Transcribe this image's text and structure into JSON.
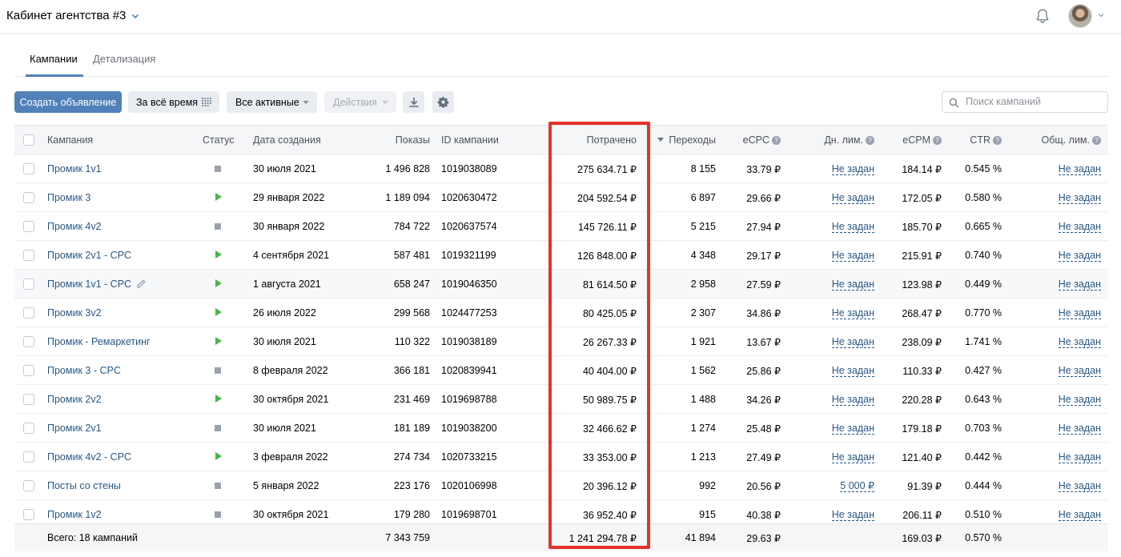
{
  "header": {
    "title": "Кабинет агентства #3"
  },
  "tabs": [
    {
      "label": "Кампании"
    },
    {
      "label": "Детализация"
    }
  ],
  "toolbar": {
    "create_label": "Создать объявление",
    "time_label": "За всё время",
    "filter_label": "Все активные",
    "actions_label": "Действия"
  },
  "search": {
    "placeholder": "Поиск кампаний",
    "value": ""
  },
  "columns": {
    "campaign": "Кампания",
    "status": "Статус",
    "created": "Дата создания",
    "shows": "Показы",
    "id": "ID кампании",
    "spent": "Потрачено",
    "clicks": "Переходы",
    "ecpc": "eCPC",
    "day_limit": "Дн. лим.",
    "ecpm": "eCPM",
    "ctr": "CTR",
    "total_limit": "Общ. лим."
  },
  "help_mark": "?",
  "rows": [
    {
      "name": "Промик 1v1",
      "status": "stopped",
      "created": "30 июля 2021",
      "shows": "1 496 828",
      "id": "1019038089",
      "spent": "275 634.71 ₽",
      "clicks": "8 155",
      "ecpc": "33.79 ₽",
      "day_limit": "Не задан",
      "ecpm": "184.14 ₽",
      "ctr": "0.545 %",
      "total_limit": "Не задан"
    },
    {
      "name": "Промик 3",
      "status": "active",
      "created": "29 января 2022",
      "shows": "1 189 094",
      "id": "1020630472",
      "spent": "204 592.54 ₽",
      "clicks": "6 897",
      "ecpc": "29.66 ₽",
      "day_limit": "Не задан",
      "ecpm": "172.05 ₽",
      "ctr": "0.580 %",
      "total_limit": "Не задан"
    },
    {
      "name": "Промик 4v2",
      "status": "stopped",
      "created": "30 января 2022",
      "shows": "784 722",
      "id": "1020637574",
      "spent": "145 726.11 ₽",
      "clicks": "5 215",
      "ecpc": "27.94 ₽",
      "day_limit": "Не задан",
      "ecpm": "185.70 ₽",
      "ctr": "0.665 %",
      "total_limit": "Не задан"
    },
    {
      "name": "Промик 2v1 - CPC",
      "status": "active",
      "created": "4 сентября 2021",
      "shows": "587 481",
      "id": "1019321199",
      "spent": "126 848.00 ₽",
      "clicks": "4 348",
      "ecpc": "29.17 ₽",
      "day_limit": "Не задан",
      "ecpm": "215.91 ₽",
      "ctr": "0.740 %",
      "total_limit": "Не задан"
    },
    {
      "name": "Промик 1v1 - CPC",
      "status": "active",
      "created": "1 августа 2021",
      "shows": "658 247",
      "id": "1019046350",
      "spent": "81 614.50 ₽",
      "clicks": "2 958",
      "ecpc": "27.59 ₽",
      "day_limit": "Не задан",
      "ecpm": "123.98 ₽",
      "ctr": "0.449 %",
      "total_limit": "Не задан",
      "hover": true
    },
    {
      "name": "Промик 3v2",
      "status": "active",
      "created": "26 июля 2022",
      "shows": "299 568",
      "id": "1024477253",
      "spent": "80 425.05 ₽",
      "clicks": "2 307",
      "ecpc": "34.86 ₽",
      "day_limit": "Не задан",
      "ecpm": "268.47 ₽",
      "ctr": "0.770 %",
      "total_limit": "Не задан"
    },
    {
      "name": "Промик - Ремаркетинг",
      "status": "active",
      "created": "30 июля 2021",
      "shows": "110 322",
      "id": "1019038189",
      "spent": "26 267.33 ₽",
      "clicks": "1 921",
      "ecpc": "13.67 ₽",
      "day_limit": "Не задан",
      "ecpm": "238.09 ₽",
      "ctr": "1.741 %",
      "total_limit": "Не задан"
    },
    {
      "name": "Промик 3 - CPC",
      "status": "stopped",
      "created": "8 февраля 2022",
      "shows": "366 181",
      "id": "1020839941",
      "spent": "40 404.00 ₽",
      "clicks": "1 562",
      "ecpc": "25.86 ₽",
      "day_limit": "Не задан",
      "ecpm": "110.33 ₽",
      "ctr": "0.427 %",
      "total_limit": "Не задан"
    },
    {
      "name": "Промик 2v2",
      "status": "active",
      "created": "30 октября 2021",
      "shows": "231 469",
      "id": "1019698788",
      "spent": "50 989.75 ₽",
      "clicks": "1 488",
      "ecpc": "34.26 ₽",
      "day_limit": "Не задан",
      "ecpm": "220.28 ₽",
      "ctr": "0.643 %",
      "total_limit": "Не задан"
    },
    {
      "name": "Промик 2v1",
      "status": "stopped",
      "created": "30 июля 2021",
      "shows": "181 189",
      "id": "1019038200",
      "spent": "32 466.62 ₽",
      "clicks": "1 274",
      "ecpc": "25.48 ₽",
      "day_limit": "Не задан",
      "ecpm": "179.18 ₽",
      "ctr": "0.703 %",
      "total_limit": "Не задан"
    },
    {
      "name": "Промик 4v2 - CPC",
      "status": "active",
      "created": "3 февраля 2022",
      "shows": "274 734",
      "id": "1020733215",
      "spent": "33 353.00 ₽",
      "clicks": "1 213",
      "ecpc": "27.49 ₽",
      "day_limit": "Не задан",
      "ecpm": "121.40 ₽",
      "ctr": "0.442 %",
      "total_limit": "Не задан"
    },
    {
      "name": "Посты со стены",
      "status": "stopped",
      "created": "5 января 2022",
      "shows": "223 176",
      "id": "1020106998",
      "spent": "20 396.12 ₽",
      "clicks": "992",
      "ecpc": "20.56 ₽",
      "day_limit": "5 000 ₽",
      "ecpm": "91.39 ₽",
      "ctr": "0.444 %",
      "total_limit": "Не задан"
    },
    {
      "name": "Промик 1v2",
      "status": "stopped",
      "created": "30 октября 2021",
      "shows": "179 280",
      "id": "1019698701",
      "spent": "36 952.40 ₽",
      "clicks": "915",
      "ecpc": "40.38 ₽",
      "day_limit": "Не задан",
      "ecpm": "206.11 ₽",
      "ctr": "0.510 %",
      "total_limit": "Не задан"
    }
  ],
  "totals": {
    "label": "Всего: 18 кампаний",
    "shows": "7 343 759",
    "spent": "1 241 294.78 ₽",
    "clicks": "41 894",
    "ecpc": "29.63 ₽",
    "ecpm": "169.03 ₽",
    "ctr": "0.570 %"
  },
  "colors": {
    "accent": "#5181b8",
    "link": "#2a5885",
    "highlight": "#e4322a",
    "active": "#4bb34b",
    "stopped": "#99a2ad"
  }
}
